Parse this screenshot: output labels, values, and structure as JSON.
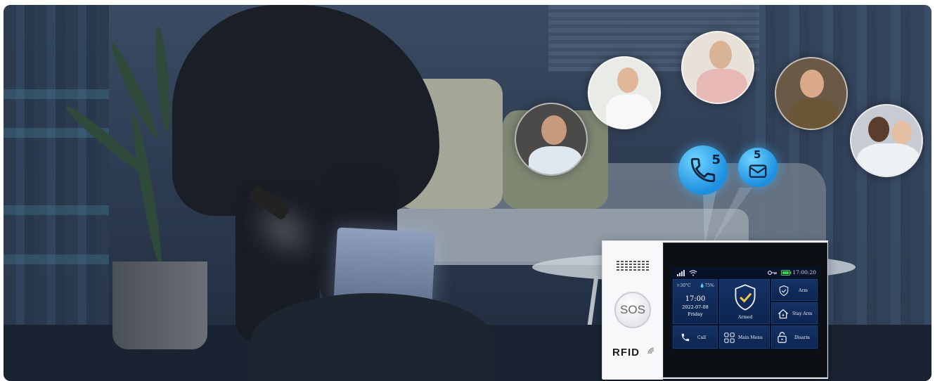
{
  "panel": {
    "sos_label": "SOS",
    "rfid_label": "RFID",
    "status_time": "17:00:20",
    "weather": {
      "temperature": "30°C",
      "humidity": "75%"
    },
    "clock": {
      "time": "17:00",
      "date": "2022-07-08",
      "day": "Friday"
    },
    "armed_label": "Armed",
    "menu": [
      {
        "label": "Arm",
        "icon": "shield-check-icon"
      },
      {
        "label": "Stay Arm",
        "icon": "home-arm-icon"
      },
      {
        "label": "Call",
        "icon": "phone-icon"
      },
      {
        "label": "Main Menu",
        "icon": "grid-menu-icon"
      },
      {
        "label": "Disarm",
        "icon": "unlock-icon"
      }
    ]
  },
  "notifications": [
    {
      "count": "5",
      "icon": "phone-call-icon"
    },
    {
      "count": "5",
      "icon": "envelope-icon"
    }
  ],
  "colors": {
    "accent": "#1d8fe0",
    "screen_bg": "#071228",
    "tile": "#143264",
    "armed_shield": "#f2c84b",
    "battery": "#3ad15a"
  }
}
